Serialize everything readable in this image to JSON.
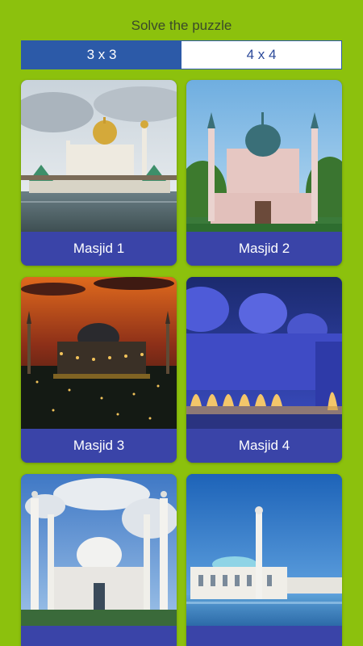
{
  "header": {
    "title": "Solve the puzzle"
  },
  "tabs": [
    {
      "label": "3 x 3",
      "active": true
    },
    {
      "label": "4 x 4",
      "active": false
    }
  ],
  "cards": [
    {
      "label": "Masjid 1"
    },
    {
      "label": "Masjid 2"
    },
    {
      "label": "Masjid 3"
    },
    {
      "label": "Masjid 4"
    },
    {
      "label": ""
    },
    {
      "label": ""
    }
  ],
  "colors": {
    "background": "#8cc10d",
    "tab_active": "#2c5aa8",
    "card_label_bg": "#3a44a8"
  }
}
